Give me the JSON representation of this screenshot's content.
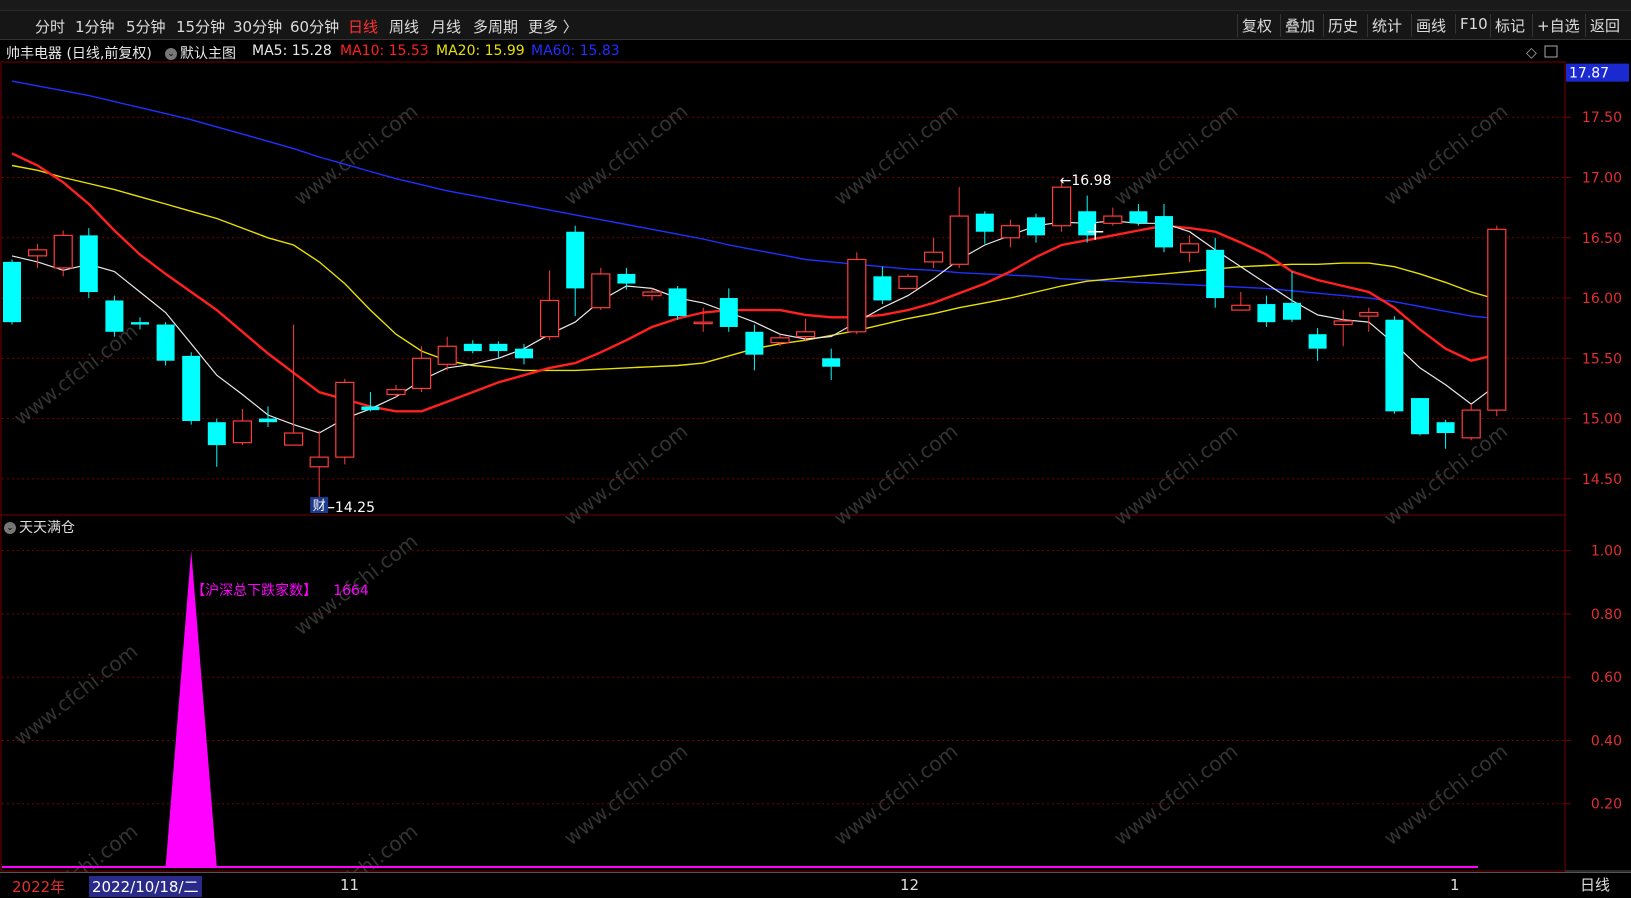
{
  "toolbar": {
    "timeframes": [
      "分时",
      "1分钟",
      "5分钟",
      "15分钟",
      "30分钟",
      "60分钟",
      "日线",
      "周线",
      "月线",
      "多周期",
      "更多 〉"
    ],
    "active_timeframe": "日线",
    "right_buttons": [
      "复权",
      "叠加",
      "历史",
      "统计",
      "画线",
      "F10",
      "标记",
      "+自选",
      "返回"
    ]
  },
  "info": {
    "stock": "帅丰电器 (日线,前复权)",
    "main_chart": "默认主图",
    "ma5": "MA5: 15.28",
    "ma10": "MA10: 15.53",
    "ma20": "MA20: 15.99",
    "ma60": "MA60: 15.83"
  },
  "colors": {
    "up": "#ff3b3b",
    "down": "#00ffff",
    "ma5": "#e8e8e8",
    "ma10": "#ff2020",
    "ma20": "#e8e000",
    "ma60": "#2030ff",
    "indicator": "#ff00ff",
    "grid": "#7a0000",
    "axis_text": "#e03030"
  },
  "indicator": {
    "title": "天天满仓",
    "label": "【沪深总下跌家数】",
    "value": "1664"
  },
  "date_axis": {
    "year": "2022年",
    "cursor_date": "2022/10/18/二",
    "month_11": "11",
    "month_12": "12",
    "month_1": "1",
    "period": "日线"
  },
  "watermark": "www.cfchi.com",
  "chart_data": [
    {
      "type": "candlestick",
      "y_range": [
        14.2,
        17.95
      ],
      "y_ticks": [
        14.5,
        15.0,
        15.5,
        16.0,
        16.5,
        17.0,
        17.5
      ],
      "y_tick_labels": [
        "14.50",
        "15.00",
        "15.50",
        "16.00",
        "16.50",
        "17.00",
        "17.50"
      ],
      "current_price_label": "17.87",
      "current_price": 17.87,
      "high_annotation": "16.98",
      "high_value": 16.98,
      "high_index": 41,
      "low_annotation": "14.25",
      "low_value": 14.25,
      "low_index": 12,
      "marker_index": 12,
      "marker_text": "财",
      "candles": [
        [
          16.3,
          15.8,
          16.32,
          15.78
        ],
        [
          16.35,
          16.4,
          16.45,
          16.25
        ],
        [
          16.25,
          16.52,
          16.56,
          16.18
        ],
        [
          16.52,
          16.05,
          16.58,
          16.0
        ],
        [
          15.98,
          15.72,
          16.02,
          15.68
        ],
        [
          15.8,
          15.78,
          15.84,
          15.74
        ],
        [
          15.78,
          15.48,
          15.8,
          15.44
        ],
        [
          15.52,
          14.98,
          15.55,
          14.95
        ],
        [
          14.97,
          14.78,
          15.0,
          14.6
        ],
        [
          14.8,
          14.98,
          15.08,
          14.78
        ],
        [
          15.0,
          14.97,
          15.1,
          14.93
        ],
        [
          14.78,
          14.88,
          15.78,
          14.78
        ],
        [
          14.6,
          14.68,
          14.9,
          14.25
        ],
        [
          14.68,
          15.3,
          15.33,
          14.62
        ],
        [
          15.1,
          15.07,
          15.22,
          15.06
        ],
        [
          15.2,
          15.24,
          15.28,
          15.18
        ],
        [
          15.25,
          15.5,
          15.6,
          15.22
        ],
        [
          15.45,
          15.6,
          15.68,
          15.4
        ],
        [
          15.62,
          15.56,
          15.65,
          15.54
        ],
        [
          15.62,
          15.56,
          15.64,
          15.5
        ],
        [
          15.58,
          15.5,
          15.62,
          15.45
        ],
        [
          15.68,
          15.98,
          16.23,
          15.65
        ],
        [
          16.55,
          16.08,
          16.6,
          15.85
        ],
        [
          15.92,
          16.2,
          16.25,
          15.9
        ],
        [
          16.2,
          16.12,
          16.25,
          16.07
        ],
        [
          16.02,
          16.05,
          16.08,
          15.98
        ],
        [
          16.08,
          15.85,
          16.1,
          15.82
        ],
        [
          15.8,
          15.8,
          15.92,
          15.72
        ],
        [
          16.0,
          15.76,
          16.08,
          15.72
        ],
        [
          15.72,
          15.53,
          15.78,
          15.4
        ],
        [
          15.63,
          15.67,
          15.7,
          15.6
        ],
        [
          15.68,
          15.72,
          15.83,
          15.64
        ],
        [
          15.5,
          15.43,
          15.58,
          15.32
        ],
        [
          15.72,
          16.32,
          16.38,
          15.7
        ],
        [
          16.18,
          15.98,
          16.26,
          15.95
        ],
        [
          16.08,
          16.18,
          16.2,
          16.08
        ],
        [
          16.3,
          16.38,
          16.5,
          16.25
        ],
        [
          16.28,
          16.68,
          16.92,
          16.25
        ],
        [
          16.7,
          16.55,
          16.72,
          16.45
        ],
        [
          16.5,
          16.6,
          16.65,
          16.42
        ],
        [
          16.67,
          16.52,
          16.7,
          16.46
        ],
        [
          16.6,
          16.92,
          16.98,
          16.55
        ],
        [
          16.72,
          16.52,
          16.85,
          16.46
        ],
        [
          16.62,
          16.68,
          16.75,
          16.6
        ],
        [
          16.72,
          16.62,
          16.78,
          16.6
        ],
        [
          16.68,
          16.42,
          16.78,
          16.38
        ],
        [
          16.38,
          16.45,
          16.52,
          16.3
        ],
        [
          16.4,
          16.0,
          16.5,
          15.92
        ],
        [
          15.9,
          15.94,
          16.05,
          15.9
        ],
        [
          15.95,
          15.8,
          16.02,
          15.76
        ],
        [
          15.96,
          15.82,
          16.22,
          15.8
        ],
        [
          15.7,
          15.58,
          15.75,
          15.48
        ],
        [
          15.78,
          15.81,
          15.9,
          15.6
        ],
        [
          15.85,
          15.88,
          15.92,
          15.72
        ],
        [
          15.82,
          15.06,
          15.85,
          15.04
        ],
        [
          15.17,
          14.87,
          15.17,
          14.86
        ],
        [
          14.97,
          14.88,
          14.99,
          14.75
        ],
        [
          14.84,
          15.07,
          15.12,
          14.82
        ],
        [
          15.07,
          16.57,
          16.6,
          15.02
        ]
      ],
      "ma5": [
        16.35,
        16.3,
        16.23,
        16.28,
        16.22,
        16.05,
        15.88,
        15.62,
        15.36,
        15.2,
        15.03,
        14.95,
        14.88,
        15.0,
        15.08,
        15.18,
        15.32,
        15.42,
        15.45,
        15.5,
        15.58,
        15.7,
        15.8,
        15.98,
        16.1,
        16.08,
        16.0,
        15.96,
        15.88,
        15.8,
        15.7,
        15.66,
        15.68,
        15.8,
        15.92,
        16.02,
        16.16,
        16.32,
        16.44,
        16.52,
        16.6,
        16.63,
        16.62,
        16.64,
        16.62,
        16.62,
        16.55,
        16.4,
        16.26,
        16.12,
        15.98,
        15.86,
        15.82,
        15.8,
        15.62,
        15.42,
        15.28,
        15.12,
        15.28
      ],
      "ma10": [
        17.2,
        17.1,
        16.96,
        16.78,
        16.56,
        16.36,
        16.2,
        16.05,
        15.9,
        15.72,
        15.54,
        15.38,
        15.22,
        15.16,
        15.1,
        15.06,
        15.06,
        15.14,
        15.22,
        15.3,
        15.36,
        15.42,
        15.46,
        15.55,
        15.65,
        15.76,
        15.83,
        15.88,
        15.9,
        15.9,
        15.9,
        15.86,
        15.84,
        15.84,
        15.86,
        15.9,
        15.96,
        16.04,
        16.12,
        16.22,
        16.34,
        16.44,
        16.48,
        16.52,
        16.56,
        16.6,
        16.58,
        16.55,
        16.46,
        16.36,
        16.22,
        16.15,
        16.1,
        16.05,
        15.92,
        15.74,
        15.58,
        15.48,
        15.53
      ],
      "ma20": [
        17.1,
        17.06,
        17.0,
        16.95,
        16.9,
        16.84,
        16.78,
        16.72,
        16.66,
        16.58,
        16.5,
        16.44,
        16.3,
        16.12,
        15.9,
        15.7,
        15.56,
        15.48,
        15.44,
        15.42,
        15.4,
        15.4,
        15.4,
        15.41,
        15.42,
        15.43,
        15.44,
        15.46,
        15.52,
        15.58,
        15.62,
        15.65,
        15.69,
        15.73,
        15.78,
        15.83,
        15.87,
        15.92,
        15.96,
        16.0,
        16.05,
        16.1,
        16.14,
        16.16,
        16.18,
        16.2,
        16.22,
        16.24,
        16.26,
        16.27,
        16.28,
        16.28,
        16.29,
        16.29,
        16.26,
        16.2,
        16.13,
        16.05,
        15.99
      ],
      "ma60": [
        17.8,
        17.76,
        17.72,
        17.68,
        17.63,
        17.58,
        17.53,
        17.48,
        17.42,
        17.36,
        17.3,
        17.24,
        17.17,
        17.11,
        17.05,
        16.99,
        16.94,
        16.89,
        16.85,
        16.81,
        16.77,
        16.73,
        16.69,
        16.65,
        16.61,
        16.57,
        16.53,
        16.49,
        16.44,
        16.4,
        16.36,
        16.32,
        16.3,
        16.28,
        16.26,
        16.24,
        16.23,
        16.21,
        16.2,
        16.19,
        16.18,
        16.16,
        16.15,
        16.14,
        16.13,
        16.12,
        16.11,
        16.1,
        16.09,
        16.08,
        16.06,
        16.04,
        16.02,
        16.0,
        15.97,
        15.93,
        15.89,
        15.85,
        15.83
      ]
    },
    {
      "type": "area",
      "title": "天天满仓",
      "y_range": [
        0,
        1.04
      ],
      "y_ticks": [
        0.2,
        0.4,
        0.6,
        0.8,
        1.0
      ],
      "y_tick_labels": [
        "0.20",
        "0.40",
        "0.60",
        "0.80",
        "1.00"
      ],
      "x_index": [
        6,
        7,
        8
      ],
      "values": [
        0,
        1.0,
        0
      ]
    }
  ]
}
